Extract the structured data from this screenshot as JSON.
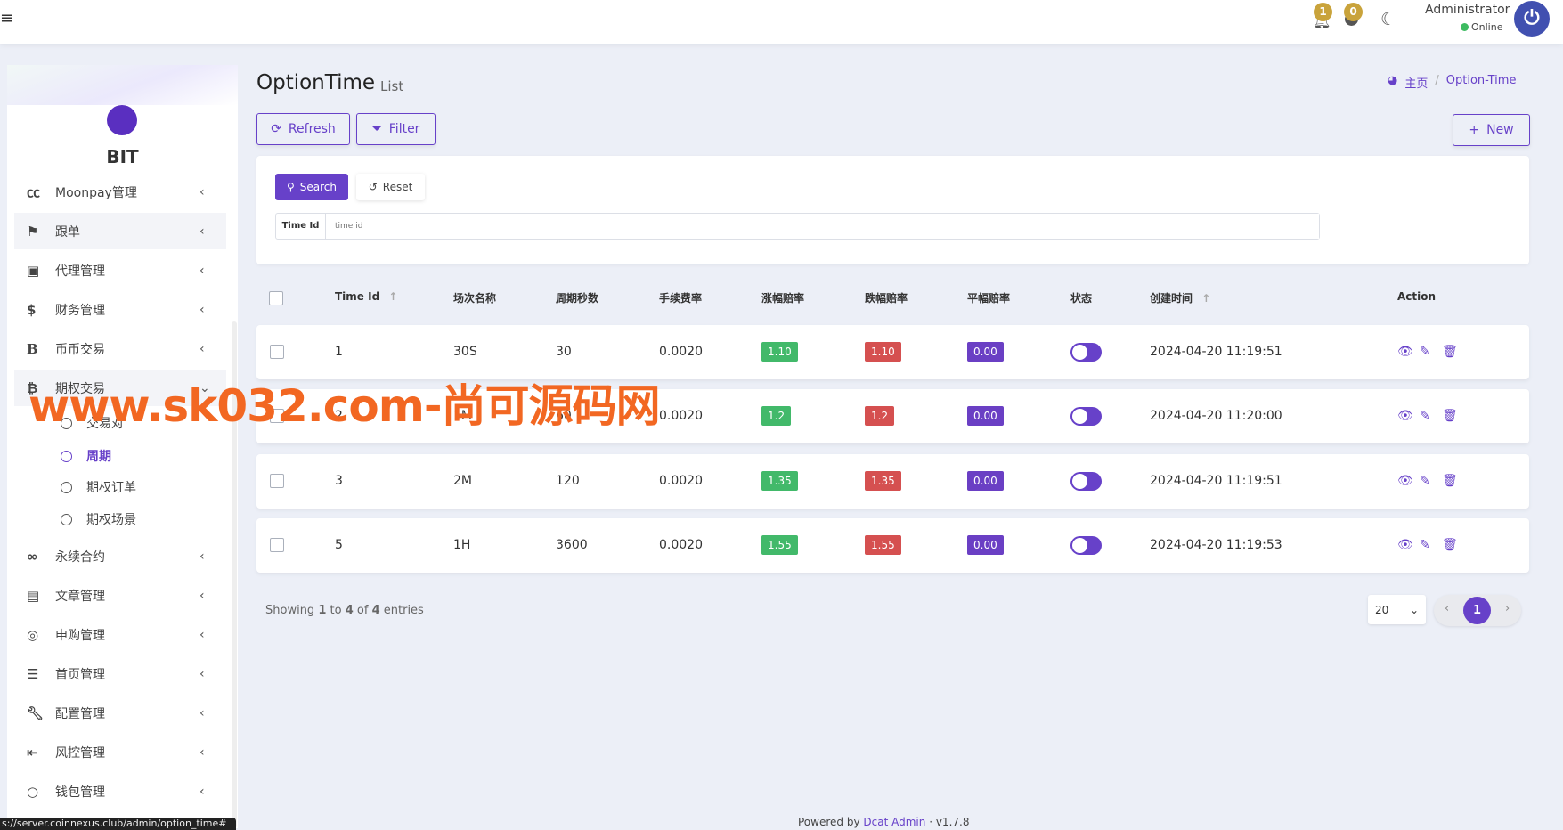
{
  "header": {
    "menu_icon": "hamburger-icon",
    "notifications_count": "1",
    "messages_count": "0",
    "user_name": "Administrator",
    "user_status": "Online",
    "status_color": "#3dbb61"
  },
  "sidebar": {
    "brand": "BIT",
    "items": [
      {
        "label": "Moonpay管理",
        "icon": "cc-icon"
      },
      {
        "label": "跟单",
        "icon": "flag-icon"
      },
      {
        "label": "代理管理",
        "icon": "id-card-icon"
      },
      {
        "label": "财务管理",
        "icon": "dollar-icon"
      },
      {
        "label": "币币交易",
        "icon": "b-icon"
      },
      {
        "label": "期权交易",
        "icon": "bitcoin-icon"
      },
      {
        "label": "永续合约",
        "icon": "link-icon"
      },
      {
        "label": "文章管理",
        "icon": "newspaper-icon"
      },
      {
        "label": "申购管理",
        "icon": "lifebuoy-icon"
      },
      {
        "label": "首页管理",
        "icon": "list-icon"
      },
      {
        "label": "配置管理",
        "icon": "wrench-icon"
      },
      {
        "label": "风控管理",
        "icon": "indent-icon"
      },
      {
        "label": "钱包管理",
        "icon": "circle-icon"
      }
    ],
    "subitems": [
      {
        "label": "交易对"
      },
      {
        "label": "周期"
      },
      {
        "label": "期权订单"
      },
      {
        "label": "期权场景"
      }
    ]
  },
  "page": {
    "title": "OptionTime",
    "subtitle": "List",
    "breadcrumb_home": "主页",
    "breadcrumb_current": "Option-Time"
  },
  "toolbar": {
    "refresh": "Refresh",
    "filter": "Filter",
    "new": "New"
  },
  "filter": {
    "search": "Search",
    "reset": "Reset",
    "field_label": "Time Id",
    "field_placeholder": "time id",
    "field_value": ""
  },
  "table": {
    "columns": [
      "Time Id",
      "场次名称",
      "周期秒数",
      "手续费率",
      "涨幅赔率",
      "跌幅赔率",
      "平幅赔率",
      "状态",
      "创建时间",
      "Action"
    ],
    "rows": [
      {
        "id": "1",
        "name": "30S",
        "seconds": "30",
        "fee": "0.0020",
        "up": "1.10",
        "down": "1.10",
        "flat": "0.00",
        "status": true,
        "created": "2024-04-20 11:19:51"
      },
      {
        "id": "2",
        "name": "1M",
        "seconds": "60",
        "fee": "0.0020",
        "up": "1.2",
        "down": "1.2",
        "flat": "0.00",
        "status": true,
        "created": "2024-04-20 11:20:00"
      },
      {
        "id": "3",
        "name": "2M",
        "seconds": "120",
        "fee": "0.0020",
        "up": "1.35",
        "down": "1.35",
        "flat": "0.00",
        "status": true,
        "created": "2024-04-20 11:19:51"
      },
      {
        "id": "5",
        "name": "1H",
        "seconds": "3600",
        "fee": "0.0020",
        "up": "1.55",
        "down": "1.55",
        "flat": "0.00",
        "status": true,
        "created": "2024-04-20 11:19:53"
      }
    ]
  },
  "pagination": {
    "showing_prefix": "Showing",
    "from": "1",
    "to_word": "to",
    "to": "4",
    "of_word": "of",
    "total": "4",
    "entries_word": "entries",
    "per_page": "20",
    "current_page": "1"
  },
  "footer": {
    "powered_by": "Powered by",
    "link": "Dcat Admin",
    "version": "v1.7.8"
  },
  "status_url": "s://server.coinnexus.club/admin/option_time#",
  "watermark": "www.sk032.com-尚可源码网",
  "colors": {
    "accent": "#6741c9",
    "green": "#42b96a",
    "red": "#d55050",
    "purple": "#6a3fc4"
  }
}
